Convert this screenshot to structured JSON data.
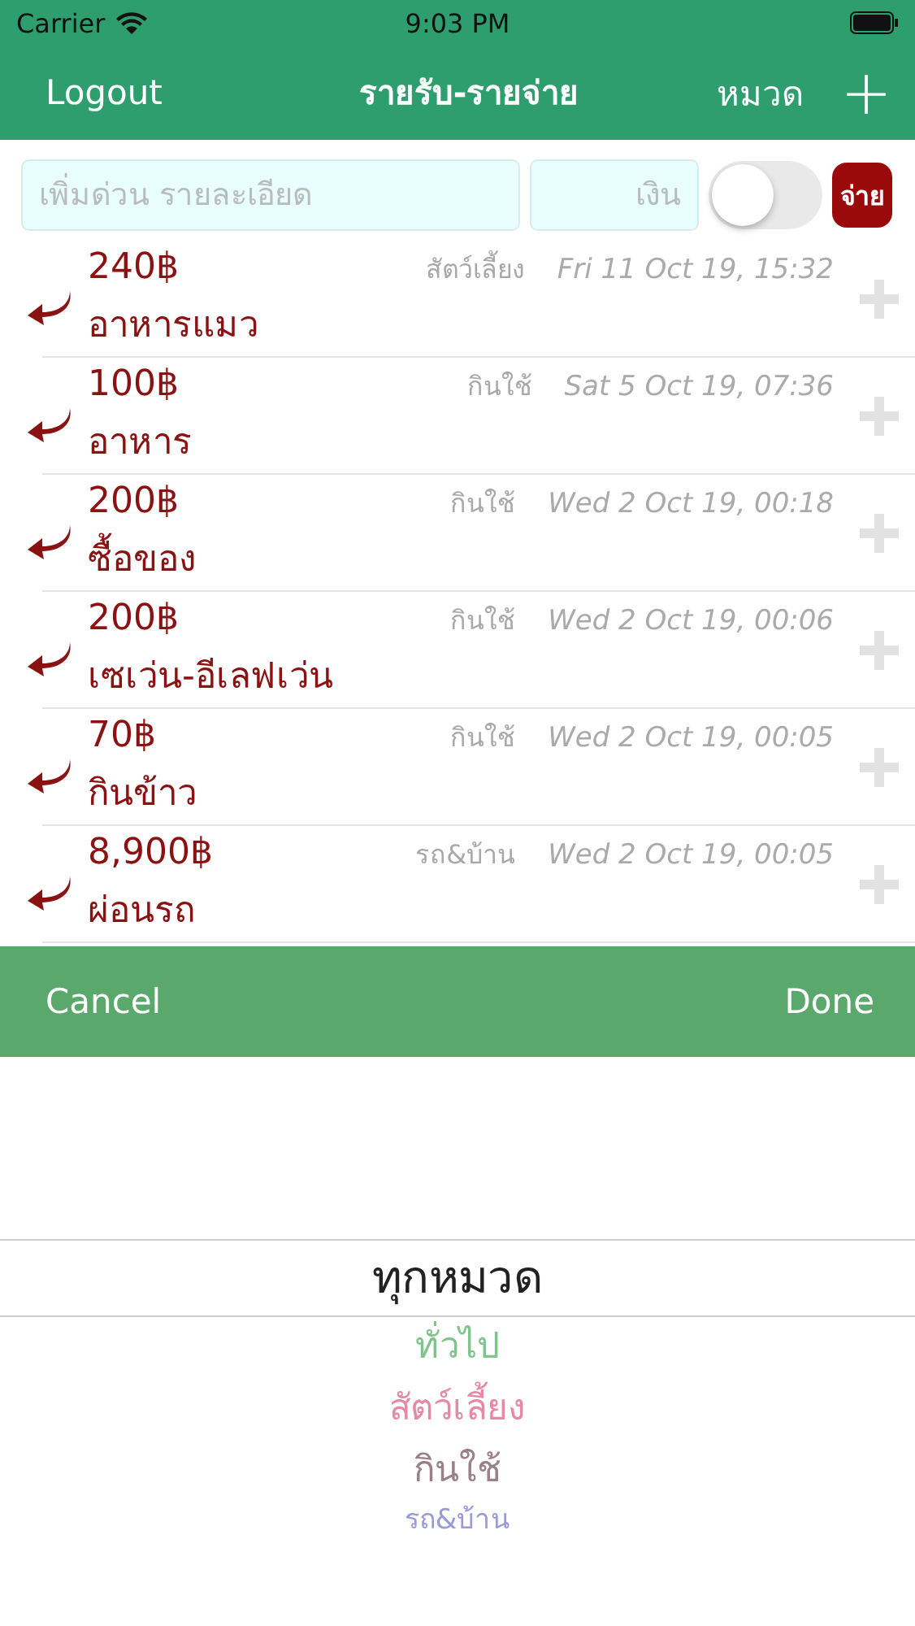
{
  "status_bar": {
    "carrier": "Carrier",
    "time": "9:03 PM"
  },
  "nav": {
    "left": "Logout",
    "title": "รายรับ-รายจ่าย",
    "right": "หมวด",
    "add": "+"
  },
  "quick_add": {
    "detail_placeholder": "เพิ่มด่วน รายละเอียด",
    "amount_placeholder": "เงิน",
    "toggle_on": false,
    "type_button": "จ่าย"
  },
  "entries": [
    {
      "amount": "240฿",
      "note": "อาหารแมว",
      "category": "สัตว์เลี้ยง",
      "date": "Fri 11 Oct 19, 15:32"
    },
    {
      "amount": "100฿",
      "note": "อาหาร",
      "category": "กินใช้",
      "date": "Sat 5 Oct 19, 07:36"
    },
    {
      "amount": "200฿",
      "note": "ซื้อของ",
      "category": "กินใช้",
      "date": "Wed 2 Oct 19, 00:18"
    },
    {
      "amount": "200฿",
      "note": "เซเว่น-อีเลฟเว่น",
      "category": "กินใช้",
      "date": "Wed 2 Oct 19, 00:06"
    },
    {
      "amount": "70฿",
      "note": "กินข้าว",
      "category": "กินใช้",
      "date": "Wed 2 Oct 19, 00:05"
    },
    {
      "amount": "8,900฿",
      "note": "ผ่อนรถ",
      "category": "รถ&บ้าน",
      "date": "Wed 2 Oct 19, 00:05"
    }
  ],
  "toolbar": {
    "cancel": "Cancel",
    "done": "Done"
  },
  "picker": [
    {
      "label": "ทุกหมวด",
      "selected": true,
      "color": "#222222"
    },
    {
      "label": "ทั่วไป",
      "selected": false,
      "color": "#7fc48a"
    },
    {
      "label": "สัตว์เลี้ยง",
      "selected": false,
      "color": "#e48aa6"
    },
    {
      "label": "กินใช้",
      "selected": false,
      "color": "#9a8088"
    },
    {
      "label": "รถ&บ้าน",
      "selected": false,
      "color": "#9a9ad8"
    }
  ]
}
